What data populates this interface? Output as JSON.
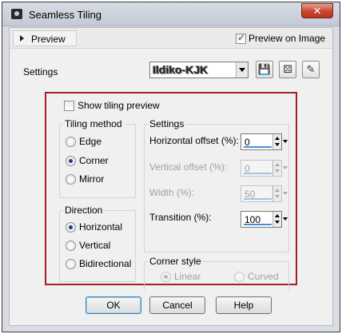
{
  "window": {
    "title": "Seamless Tiling",
    "close_glyph": "✕"
  },
  "topbar": {
    "preview_label": "Preview",
    "preview_on_image_label": "Preview on Image",
    "preview_on_image_checked": true
  },
  "settings": {
    "label": "Settings",
    "preset_value": "Ildiko-KJK",
    "tools": [
      {
        "icon": "save-icon",
        "glyph": "💾"
      },
      {
        "icon": "dice-icon",
        "glyph": "⚄"
      },
      {
        "icon": "edit-preset-icon",
        "glyph": "✎"
      }
    ]
  },
  "panel": {
    "show_tiling_preview": {
      "label": "Show tiling preview",
      "checked": false
    },
    "tiling_method": {
      "title": "Tiling method",
      "options": [
        {
          "label": "Edge",
          "selected": false
        },
        {
          "label": "Corner",
          "selected": true
        },
        {
          "label": "Mirror",
          "selected": false
        }
      ]
    },
    "direction": {
      "title": "Direction",
      "options": [
        {
          "label": "Horizontal",
          "selected": true
        },
        {
          "label": "Vertical",
          "selected": false
        },
        {
          "label": "Bidirectional",
          "selected": false
        }
      ]
    },
    "settings_group": {
      "title": "Settings",
      "fields": [
        {
          "label": "Horizontal offset (%):",
          "value": "0",
          "enabled": true
        },
        {
          "label": "Vertical offset (%):",
          "value": "0",
          "enabled": false
        },
        {
          "label": "Width (%):",
          "value": "50",
          "enabled": false
        },
        {
          "label": "Transition (%):",
          "value": "100",
          "enabled": true
        }
      ]
    },
    "corner_style": {
      "title": "Corner style",
      "options": [
        {
          "label": "Linear",
          "selected": true,
          "enabled": false
        },
        {
          "label": "Curved",
          "selected": false,
          "enabled": false
        }
      ]
    }
  },
  "buttons": {
    "ok": "OK",
    "cancel": "Cancel",
    "help": "Help"
  },
  "colors": {
    "frame_highlight": "#a51f24",
    "accent": "#4a8fd6"
  }
}
